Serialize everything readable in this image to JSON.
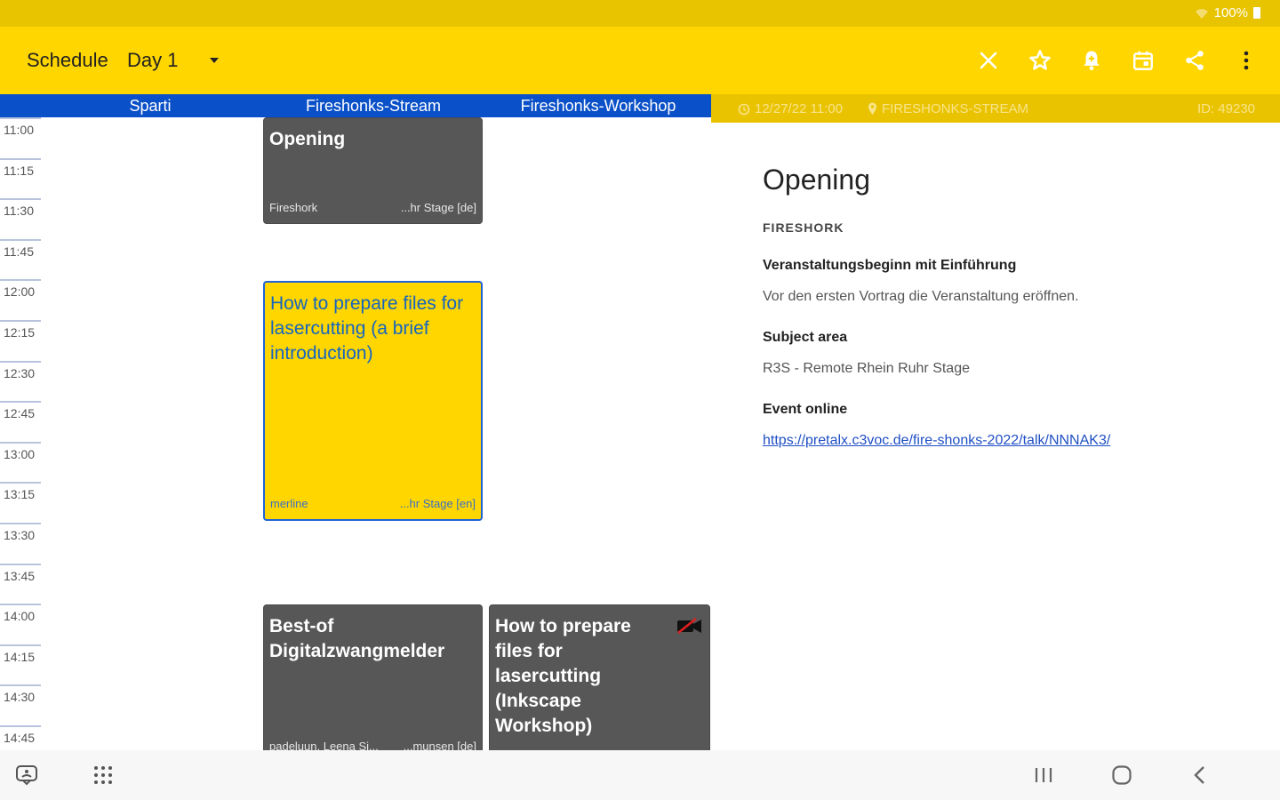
{
  "status_bar": {
    "battery_text": "100%"
  },
  "app_bar": {
    "title": "Schedule",
    "day": "Day 1",
    "actions": [
      "close-icon",
      "star-icon",
      "alarm-add-icon",
      "calendar-icon",
      "share-icon",
      "more-vert-icon"
    ]
  },
  "rooms": [
    "Sparti",
    "Fireshonks-Stream",
    "Fireshonks-Workshop"
  ],
  "times": [
    "11:00",
    "11:15",
    "11:30",
    "11:45",
    "12:00",
    "12:15",
    "12:30",
    "12:45",
    "13:00",
    "13:15",
    "13:30",
    "13:45",
    "14:00",
    "14:15",
    "14:30",
    "14:45"
  ],
  "events": {
    "opening": {
      "title": "Opening",
      "speaker": "Fireshork",
      "room": "...hr Stage [de]"
    },
    "laser_intro": {
      "title": "How to prepare files for lasercutting (a brief introduction)",
      "speaker": "merline",
      "room": "...hr Stage [en]"
    },
    "best_of": {
      "title": "Best-of Digitalzwangmelder",
      "speaker": "padeluun, Leena Si...",
      "room": "...munsen [de]"
    },
    "laser_workshop": {
      "title": "How to prepare files for lasercutting (Inkscape Workshop)"
    }
  },
  "detail": {
    "date_time": "12/27/22 11:00",
    "room": "FIRESHONKS-STREAM",
    "id": "ID: 49230",
    "title": "Opening",
    "speaker": "FIRESHORK",
    "subtitle": "Veranstaltungsbeginn mit Einführung",
    "abstract": "Vor den ersten Vortrag die Veranstaltung eröffnen.",
    "subject_area_label": "Subject area",
    "subject_area": "R3S - Remote Rhein Ruhr Stage",
    "event_online_label": "Event online",
    "event_url": "https://pretalx.c3voc.de/fire-shonks-2022/talk/NNNAK3/"
  },
  "colors": {
    "accent": "#ffd600",
    "room_bar": "#0a50c8",
    "event_dark": "#575757",
    "link": "#1f4fc4"
  }
}
